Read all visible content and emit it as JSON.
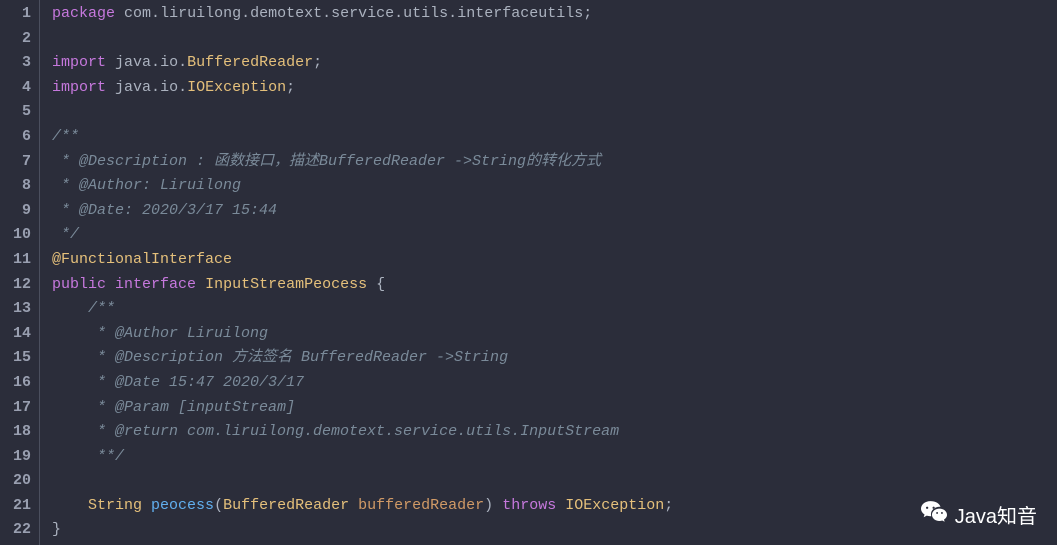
{
  "lines": [
    "1",
    "2",
    "3",
    "4",
    "5",
    "6",
    "7",
    "8",
    "9",
    "10",
    "11",
    "12",
    "13",
    "14",
    "15",
    "16",
    "17",
    "18",
    "19",
    "20",
    "21",
    "22"
  ],
  "code": {
    "l1": {
      "kw": "package",
      "p1": "com",
      "p2": "liruilong",
      "p3": "demotext",
      "p4": "service",
      "p5": "utils",
      "p6": "interfaceutils",
      "dot": ".",
      "semi": ";"
    },
    "l3": {
      "kw": "import",
      "p1": "java",
      "p2": "io",
      "cls": "BufferedReader"
    },
    "l4": {
      "kw": "import",
      "p1": "java",
      "p2": "io",
      "cls": "IOException"
    },
    "l6": "/**",
    "l7": " * @Description : 函数接口，描述BufferedReader ->String的转化方式",
    "l8": " * @Author: Liruilong",
    "l9": " * @Date: 2020/3/17 15:44",
    "l10": " */",
    "l11": "@FunctionalInterface",
    "l12": {
      "kw1": "public",
      "kw2": "interface",
      "name": "InputStreamPeocess",
      "brace": "{"
    },
    "l13": "    /**",
    "l14": "     * @Author Liruilong",
    "l15": "     * @Description 方法签名 BufferedReader ->String",
    "l16": "     * @Date 15:47 2020/3/17",
    "l17": "     * @Param [inputStream]",
    "l18": "     * @return com.liruilong.demotext.service.utils.InputStream",
    "l19": "     **/",
    "l21": {
      "ret": "String",
      "method": "peocess",
      "ptype": "BufferedReader",
      "pname": "bufferedReader",
      "kw": "throws",
      "exc": "IOException"
    },
    "l22": "}"
  },
  "watermark": "Java知音"
}
